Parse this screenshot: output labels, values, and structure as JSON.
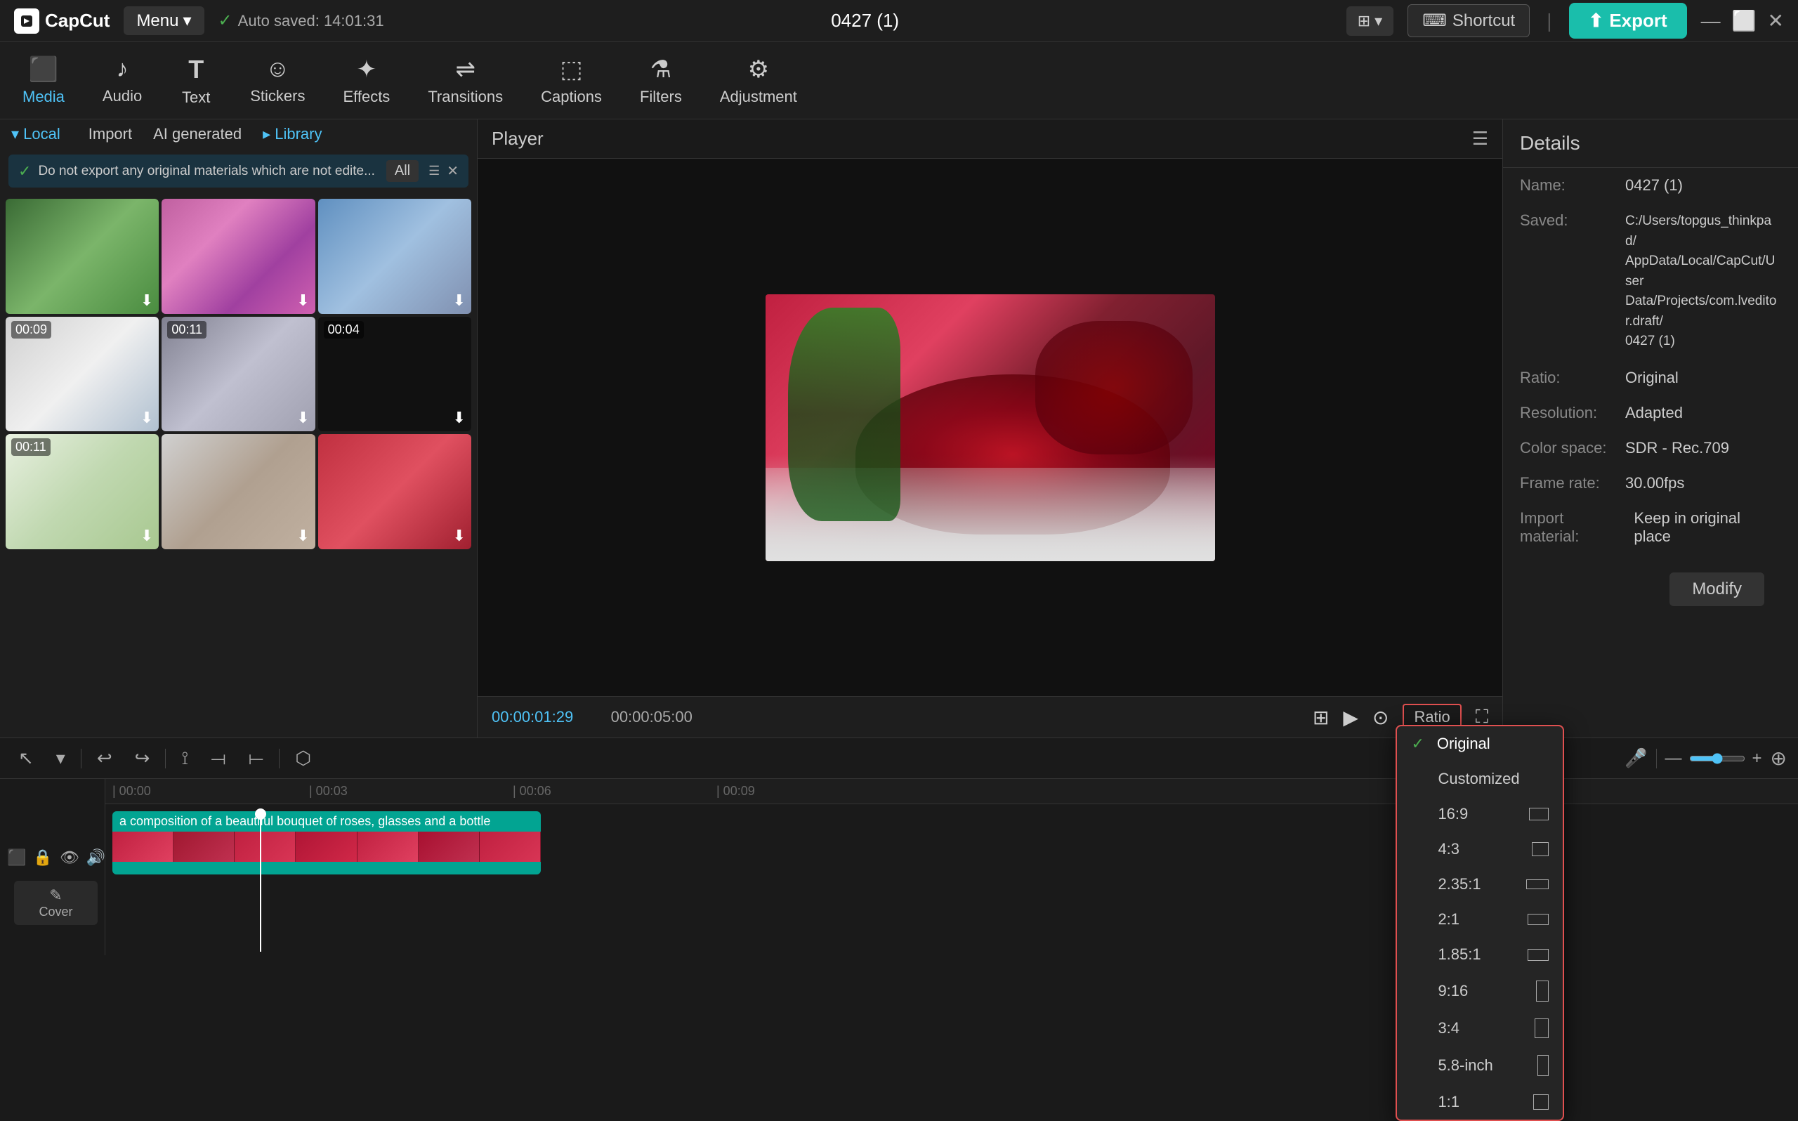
{
  "app": {
    "name": "CapCut",
    "menu_label": "Menu",
    "autosave_text": "Auto saved: 14:01:31",
    "title": "0427 (1)",
    "shortcut_label": "Shortcut",
    "export_label": "Export"
  },
  "toolbar": {
    "items": [
      {
        "id": "media",
        "label": "Media",
        "icon": "⬛",
        "active": true
      },
      {
        "id": "audio",
        "label": "Audio",
        "icon": "♪"
      },
      {
        "id": "text",
        "label": "Text",
        "icon": "T"
      },
      {
        "id": "stickers",
        "label": "Stickers",
        "icon": "☺"
      },
      {
        "id": "effects",
        "label": "Effects",
        "icon": "✦"
      },
      {
        "id": "transitions",
        "label": "Transitions",
        "icon": "⇌"
      },
      {
        "id": "captions",
        "label": "Captions",
        "icon": "⬚"
      },
      {
        "id": "filters",
        "label": "Filters",
        "icon": "⧖"
      },
      {
        "id": "adjustment",
        "label": "Adjustment",
        "icon": "⚙"
      }
    ]
  },
  "left_panel": {
    "nav": [
      {
        "id": "local",
        "label": "▾ Local",
        "active": true
      },
      {
        "id": "import",
        "label": "Import"
      },
      {
        "id": "ai_gen",
        "label": "AI generated"
      },
      {
        "id": "library",
        "label": "▸ Library"
      }
    ],
    "info_bar": {
      "text": "Do not export any original materials which are not edite...",
      "filter_label": "All"
    },
    "media_items": [
      {
        "id": 1,
        "thumb_class": "thumb-1",
        "duration": ""
      },
      {
        "id": 2,
        "thumb_class": "thumb-2",
        "duration": ""
      },
      {
        "id": 3,
        "thumb_class": "thumb-3",
        "duration": ""
      },
      {
        "id": 4,
        "thumb_class": "thumb-4",
        "duration": "00:09"
      },
      {
        "id": 5,
        "thumb_class": "thumb-5",
        "duration": "00:11"
      },
      {
        "id": 6,
        "thumb_class": "thumb-6",
        "duration": "00:04"
      },
      {
        "id": 7,
        "thumb_class": "thumb-7",
        "duration": "00:11"
      },
      {
        "id": 8,
        "thumb_class": "thumb-8",
        "duration": ""
      },
      {
        "id": 9,
        "thumb_class": "thumb-9",
        "duration": ""
      },
      {
        "id": 10,
        "thumb_class": "thumb-10",
        "duration": ""
      }
    ]
  },
  "player": {
    "title": "Player",
    "time_current": "00:00:01:29",
    "time_total": "00:00:05:00",
    "ratio_label": "Ratio"
  },
  "ratio_dropdown": {
    "options": [
      {
        "id": "original",
        "label": "Original",
        "selected": true,
        "icon": null
      },
      {
        "id": "customized",
        "label": "Customized",
        "icon": null
      },
      {
        "id": "16_9",
        "label": "16:9",
        "icon": "wide"
      },
      {
        "id": "4_3",
        "label": "4:3",
        "icon": "med"
      },
      {
        "id": "2_35_1",
        "label": "2.35:1",
        "icon": "cinema"
      },
      {
        "id": "2_1",
        "label": "2:1",
        "icon": "two1"
      },
      {
        "id": "1_85_1",
        "label": "1.85:1",
        "icon": "r185"
      },
      {
        "id": "9_16",
        "label": "9:16",
        "icon": "tall"
      },
      {
        "id": "3_4",
        "label": "3:4",
        "icon": "tall34"
      },
      {
        "id": "5_8_inch",
        "label": "5.8-inch",
        "icon": "phone"
      },
      {
        "id": "1_1",
        "label": "1:1",
        "icon": "square"
      }
    ]
  },
  "details": {
    "title": "Details",
    "rows": [
      {
        "label": "Name:",
        "value": "0427 (1)"
      },
      {
        "label": "Saved:",
        "value": "C:/Users/topgus_thinkpad/\nAppData/Local/CapCut/User\nData/Projects/com.lveditor.draft/\n0427 (1)"
      },
      {
        "label": "Ratio:",
        "value": "Original"
      },
      {
        "label": "Resolution:",
        "value": "Adapted"
      },
      {
        "label": "Color space:",
        "value": "SDR - Rec.709"
      },
      {
        "label": "Frame rate:",
        "value": "30.00fps"
      },
      {
        "label": "Import material:",
        "value": "Keep in original place"
      }
    ],
    "modify_label": "Modify"
  },
  "timeline": {
    "playhead_position": "00:00",
    "markers": [
      "| 00:00",
      "| 00:03",
      "| 00:06",
      "| 00:09"
    ],
    "clip_label": "a composition of a beautiful bouquet of roses, glasses and a bottle",
    "cover_label": "Cover"
  }
}
